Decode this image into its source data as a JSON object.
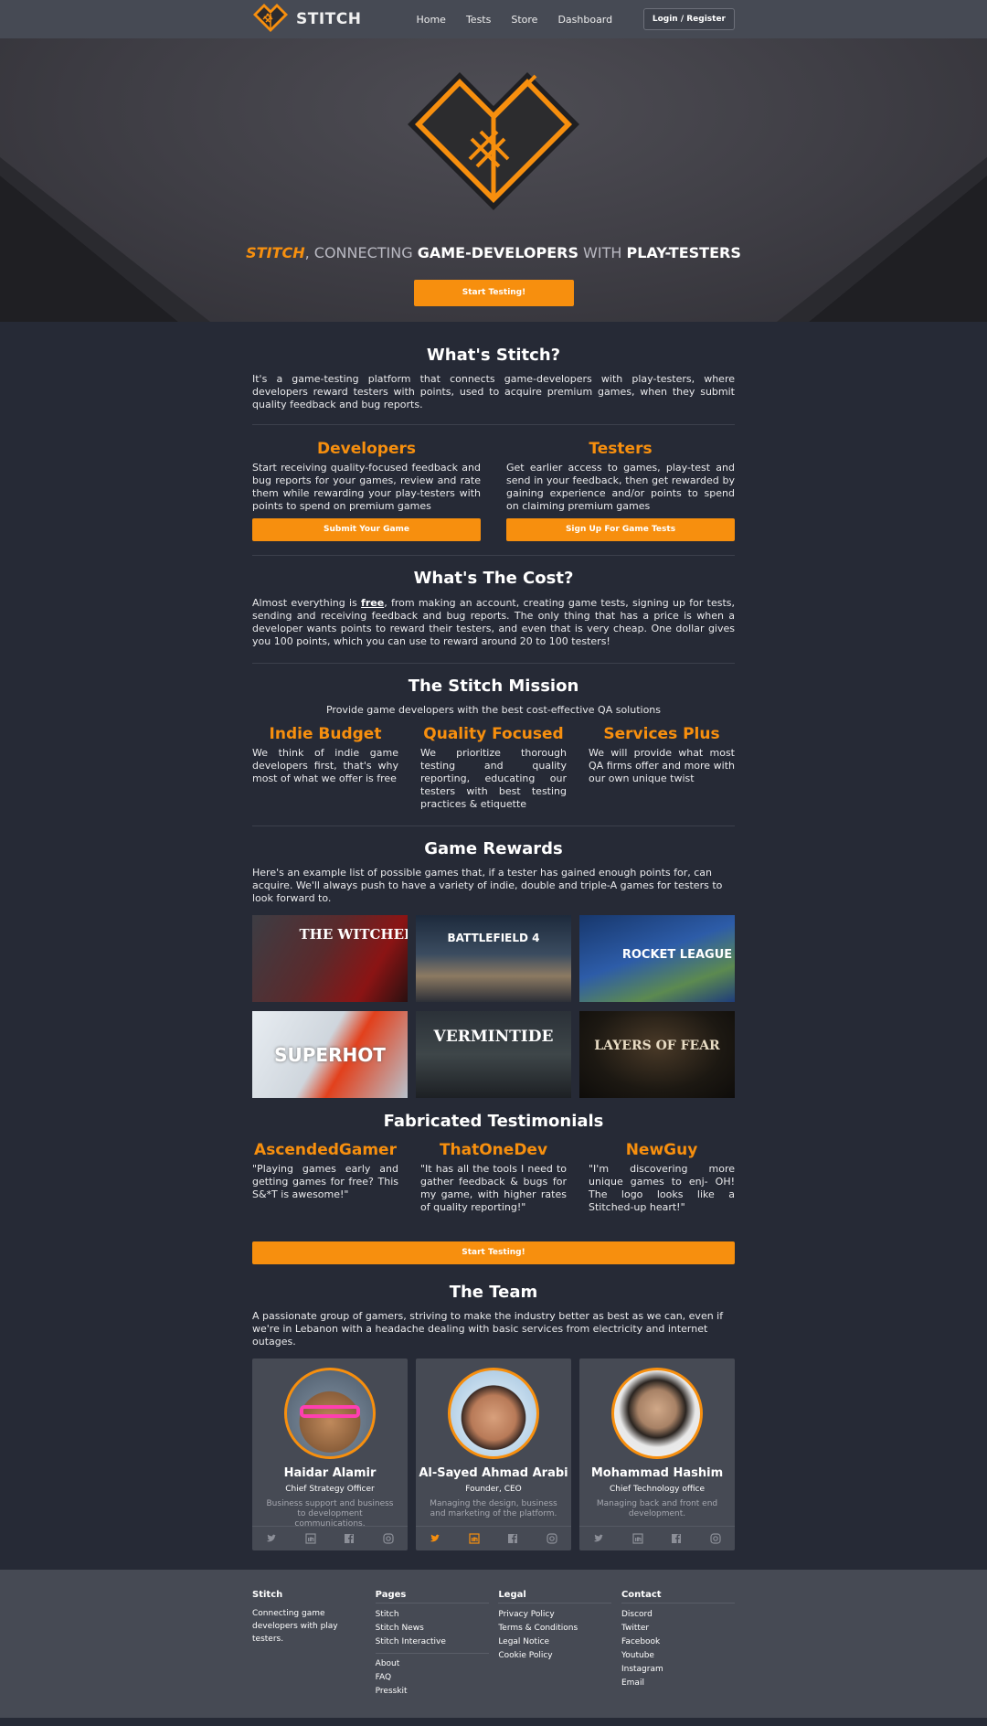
{
  "nav": {
    "brand": "STITCH",
    "links": [
      "Home",
      "Tests",
      "Store",
      "Dashboard"
    ],
    "login": "Login / Register"
  },
  "hero": {
    "tag_stitch": "STITCH",
    "tag_comma": ",",
    "tag_connecting": " CONNECTING ",
    "tag_devs": "GAME-DEVELOPERS",
    "tag_with": " WITH ",
    "tag_testers": "PLAY-TESTERS",
    "cta": "Start Testing!"
  },
  "what": {
    "title": "What's Stitch?",
    "body": "It's a game-testing platform that connects game-developers with play-testers, where developers reward testers with points, used to acquire premium games, when they submit quality feedback and bug reports."
  },
  "roles": {
    "developers": {
      "title": "Developers",
      "body": "Start receiving quality-focused feedback and bug reports for your games, review and rate them while rewarding your play-testers with points to spend on premium games",
      "button": "Submit Your Game"
    },
    "testers": {
      "title": "Testers",
      "body": "Get earlier access to games, play-test and send in your feedback, then get rewarded by gaining experience and/or points to spend on claiming premium games",
      "button": "Sign Up For Game Tests"
    }
  },
  "cost": {
    "title": "What's The Cost?",
    "pre": "Almost everything is ",
    "free": "free",
    "post": ", from making an account, creating game tests, signing up for tests, sending and receiving feedback and bug reports. The only thing that has a price is when a developer wants points to reward their testers, and even that is very cheap. One dollar gives you 100 points, which you can use to reward around 20 to 100 testers!"
  },
  "mission": {
    "title": "The Stitch Mission",
    "subtitle": "Provide game developers with the best cost-effective QA solutions",
    "items": [
      {
        "title": "Indie Budget",
        "body": "We think of indie game developers first, that's why most of what we offer is free"
      },
      {
        "title": "Quality Focused",
        "body": "We prioritize thorough testing and quality reporting, educating our testers with best testing practices & etiquette"
      },
      {
        "title": "Services Plus",
        "body": "We will provide what most QA firms offer and more with our own unique twist"
      }
    ]
  },
  "rewards": {
    "title": "Game Rewards",
    "body": "Here's an example list of possible games that, if a tester has gained enough points for, can acquire. We'll always push to have a variety of indie, double and triple-A games for testers to look forward to.",
    "games": [
      {
        "label": "THE WITCHER"
      },
      {
        "label": "BATTLEFIELD 4"
      },
      {
        "label": "ROCKET LEAGUE"
      },
      {
        "label": "SUPERHOT"
      },
      {
        "label": "VERMINTIDE"
      },
      {
        "label": "LAYERS OF FEAR"
      }
    ]
  },
  "testimonials": {
    "title": "Fabricated Testimonials",
    "items": [
      {
        "name": "AscendedGamer",
        "quote": "\"Playing games early and getting games for free? This S&*T is awesome!\""
      },
      {
        "name": "ThatOneDev",
        "quote": "\"It has all the tools I need to gather feedback & bugs for my game, with higher rates of quality reporting!\""
      },
      {
        "name": "NewGuy",
        "quote": "\"I'm discovering more unique games to enj- OH! The logo looks like a Stitched-up heart!\""
      }
    ],
    "cta": "Start Testing!"
  },
  "team": {
    "title": "The Team",
    "body": "A passionate group of gamers, striving to make the industry better as best as we can, even if we're in Lebanon with a headache dealing with basic services from electricity and internet outages.",
    "members": [
      {
        "name": "Haidar Alamir",
        "role": "Chief Strategy Officer",
        "desc": "Business support and business to development communications."
      },
      {
        "name": "Al-Sayed Ahmad Arabi",
        "role": "Founder, CEO",
        "desc": "Managing the design, business and marketing of the platform."
      },
      {
        "name": "Mohammad Hashim",
        "role": "Chief Technology office",
        "desc": "Managing back and front end development."
      }
    ],
    "social_icons": [
      "twitter-icon",
      "linkedin-icon",
      "facebook-icon",
      "instagram-icon"
    ]
  },
  "footer": {
    "stitch": {
      "title": "Stitch",
      "body": "Connecting game developers with play testers."
    },
    "pages": {
      "title": "Pages",
      "group1": [
        "Stitch",
        "Stitch News",
        "Stitch Interactive"
      ],
      "group2": [
        "About",
        "FAQ",
        "Presskit"
      ]
    },
    "legal": {
      "title": "Legal",
      "links": [
        "Privacy Policy",
        "Terms & Conditions",
        "Legal Notice",
        "Cookie Policy"
      ]
    },
    "contact": {
      "title": "Contact",
      "links": [
        "Discord",
        "Twitter",
        "Facebook",
        "Youtube",
        "Instagram",
        "Email"
      ]
    }
  },
  "colors": {
    "accent": "#f78f0e",
    "background": "#262a36",
    "panel": "#464a54"
  }
}
